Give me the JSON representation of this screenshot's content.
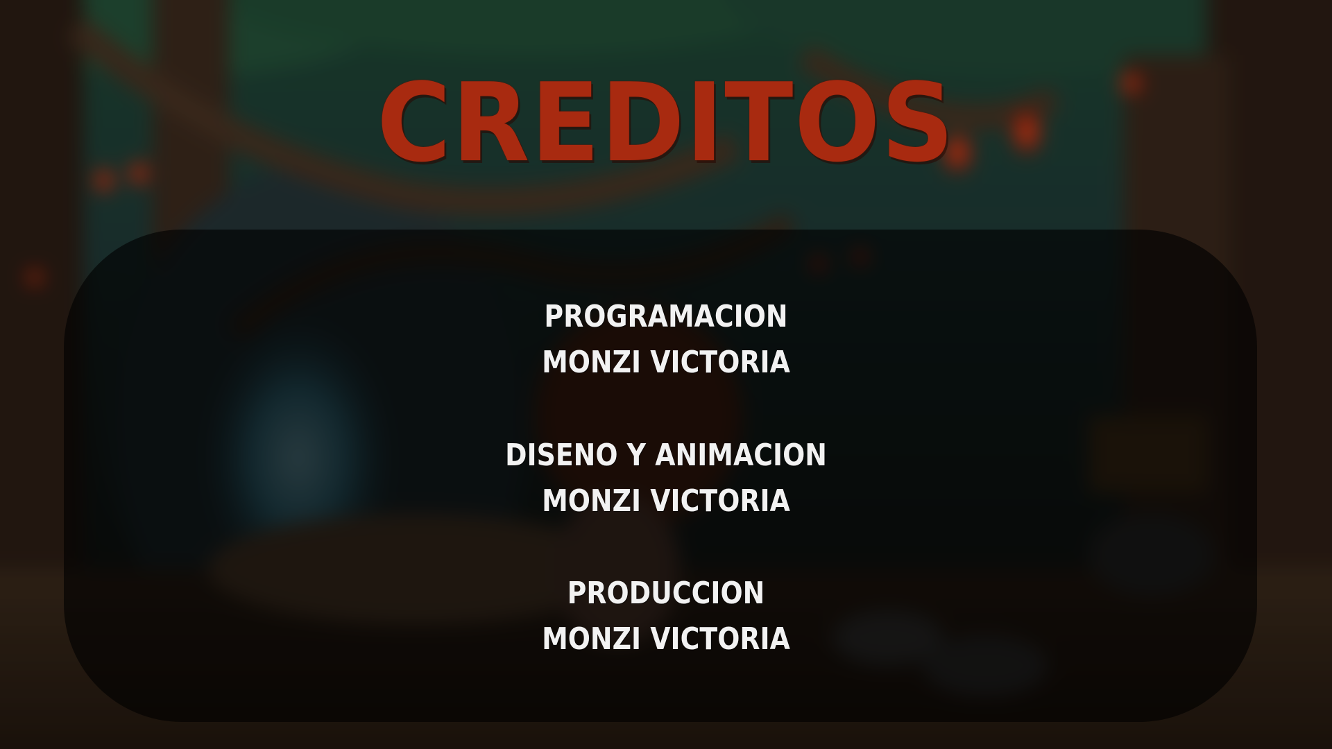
{
  "screen": {
    "title": "CREDITOS",
    "credits": [
      {
        "role": "PROGRAMACION",
        "name": "MONZI VICTORIA"
      },
      {
        "role": "DISENO Y ANIMACION",
        "name": "MONZI VICTORIA"
      },
      {
        "role": "PRODUCCION",
        "name": "MONZI VICTORIA"
      }
    ]
  },
  "colors": {
    "title": "#a82a10",
    "credit_text": "#f2f2f2",
    "panel": "rgba(0,0,0,0.62)",
    "eyes": "#ff3a12"
  }
}
